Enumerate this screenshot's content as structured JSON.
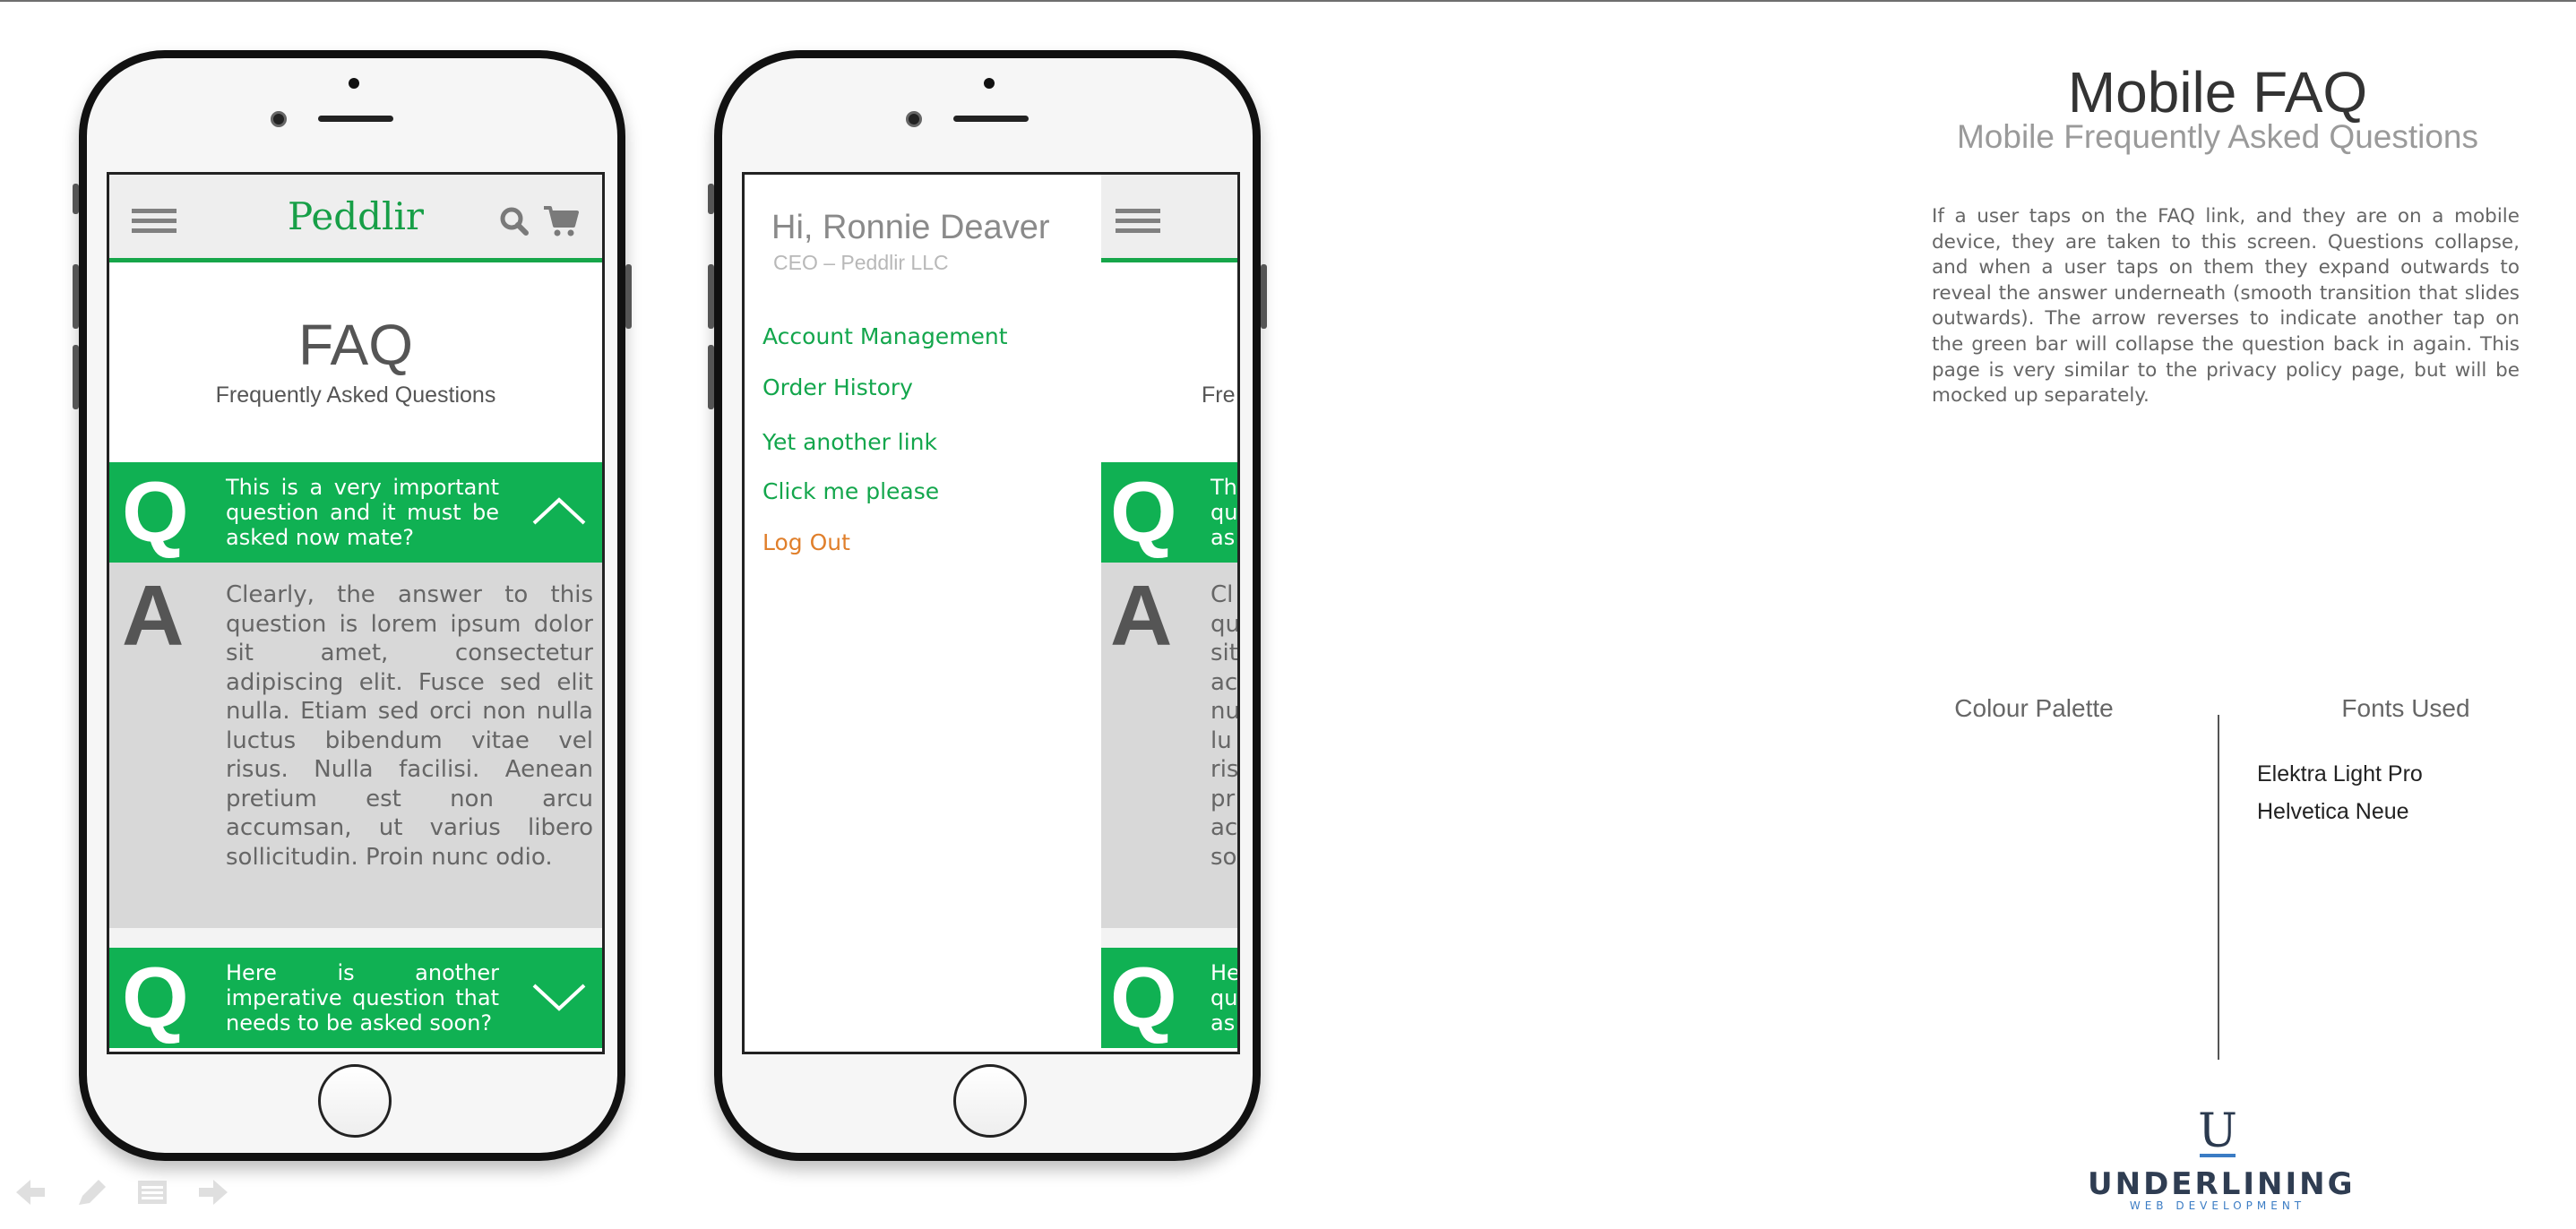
{
  "app": {
    "brand": "Peddlir",
    "faq_title": "FAQ",
    "faq_subtitle": "Frequently Asked Questions",
    "faq_subtitle_peek": "Fre",
    "questions": [
      {
        "letter": "Q",
        "text": "This is a very important question and it must be asked now mate?",
        "state": "expanded",
        "peek": "Th\nqu\nas"
      },
      {
        "letter": "Q",
        "text": "Here is another imperative question that needs to be asked soon?",
        "state": "collapsed",
        "peek": "He\nqu\nas"
      }
    ],
    "answer": {
      "letter": "A",
      "text": "Clearly, the answer to this question is lorem ipsum dolor sit amet, consectetur adipiscing elit. Fusce sed elit nulla. Etiam sed orci non nulla luctus bibendum vitae vel risus. Nulla facilisi. Aenean pretium est non arcu accumsan, ut varius libero sollicitudin. Proin nunc odio.",
      "peek": "Cl\nqu\nsit\nac\nnu\nlu\nris\npr\nac\nso"
    }
  },
  "drawer": {
    "greeting": "Hi, Ronnie Deaver",
    "role": "CEO – Peddlir LLC",
    "menu": [
      {
        "label": "Account Management"
      },
      {
        "label": "Order History"
      },
      {
        "label": "Yet another link"
      },
      {
        "label": "Click me please"
      },
      {
        "label": "Log Out",
        "accent": "orange"
      }
    ]
  },
  "info": {
    "title": "Mobile FAQ",
    "subtitle": "Mobile Frequently Asked Questions",
    "description": "If a user taps on the FAQ link, and they are on a mobile device, they are taken to this screen. Questions collapse, and when a user taps on them they expand outwards to reveal the answer underneath (smooth transition that slides outwards).  The arrow reverses to indicate another tap on the green bar will collapse the question back in again.  This page is very similar to the privacy policy page, but will be mocked up separately.",
    "palette_label": "Colour Palette",
    "fonts_label": "Fonts Used",
    "fonts": [
      "Elektra Light Pro",
      "Helvetica Neue"
    ]
  },
  "logo": {
    "mark": "U",
    "name": "UNDERLINING",
    "tagline": "WEB DEVELOPMENT"
  },
  "viewer_toolbar": {
    "icons": [
      "arrow-left-icon",
      "pen-icon",
      "menu-icon",
      "arrow-right-icon"
    ]
  },
  "colors": {
    "accent_green": "#10b153",
    "brand_green": "#179f47",
    "logout_orange": "#e07f2b",
    "answer_bg": "#d8d8d8",
    "logo_navy": "#2f3d52",
    "logo_blue": "#3b7cc4"
  }
}
